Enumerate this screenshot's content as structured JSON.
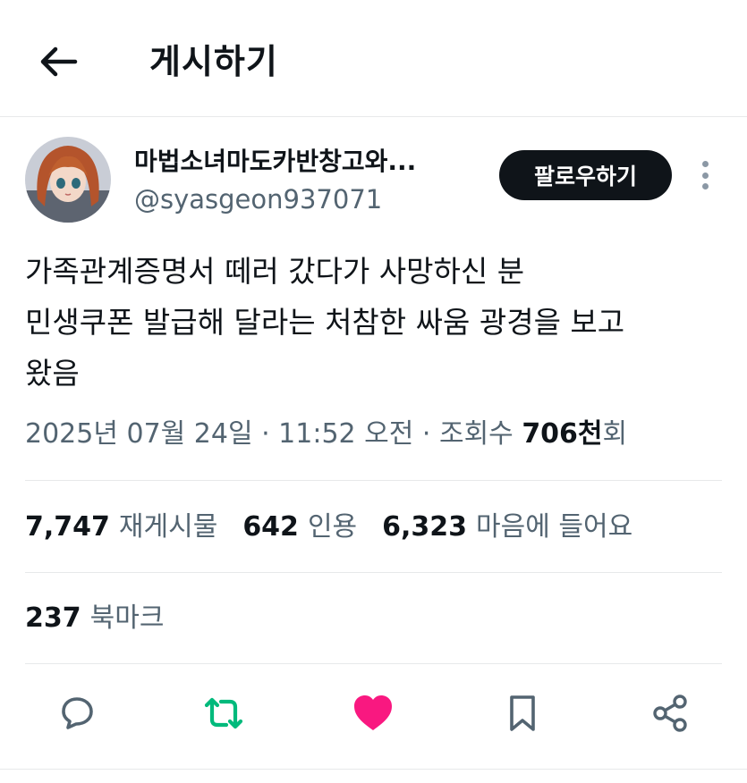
{
  "header": {
    "title": "게시하기",
    "back_icon": "arrow-left-icon"
  },
  "author": {
    "display_name": "마법소녀마도카반창고와...",
    "handle": "@syasgeon937071",
    "follow_label": "팔로우하기",
    "more_icon": "more-vertical-icon"
  },
  "tweet": {
    "lines": [
      "가족관계증명서 떼러 갔다가 사망하신 분",
      "민생쿠폰 발급해 달라는 처참한 싸움 광경을 보고",
      "왔음"
    ]
  },
  "meta": {
    "datetime": "2025년 07월 24일 · 11:52 오전 · 조회수 ",
    "views_value": "706천",
    "views_suffix": "회"
  },
  "stats": {
    "reposts_value": "7,747",
    "reposts_label": "재게시물",
    "quotes_value": "642",
    "quotes_label": "인용",
    "likes_value": "6,323",
    "likes_label": "마음에 들어요"
  },
  "bookmarks": {
    "value": "237",
    "label": "북마크"
  },
  "actions": {
    "reply_icon": "reply-bubble-icon",
    "repost_icon": "repost-icon",
    "like_icon": "heart-icon",
    "bookmark_icon": "bookmark-icon",
    "share_icon": "share-icon"
  },
  "colors": {
    "text": "#0f1419",
    "muted": "#536471",
    "divider": "#e7e9ea",
    "repost_green": "#00ba7c",
    "like_pink": "#f91880",
    "button_dark": "#0f1419"
  }
}
